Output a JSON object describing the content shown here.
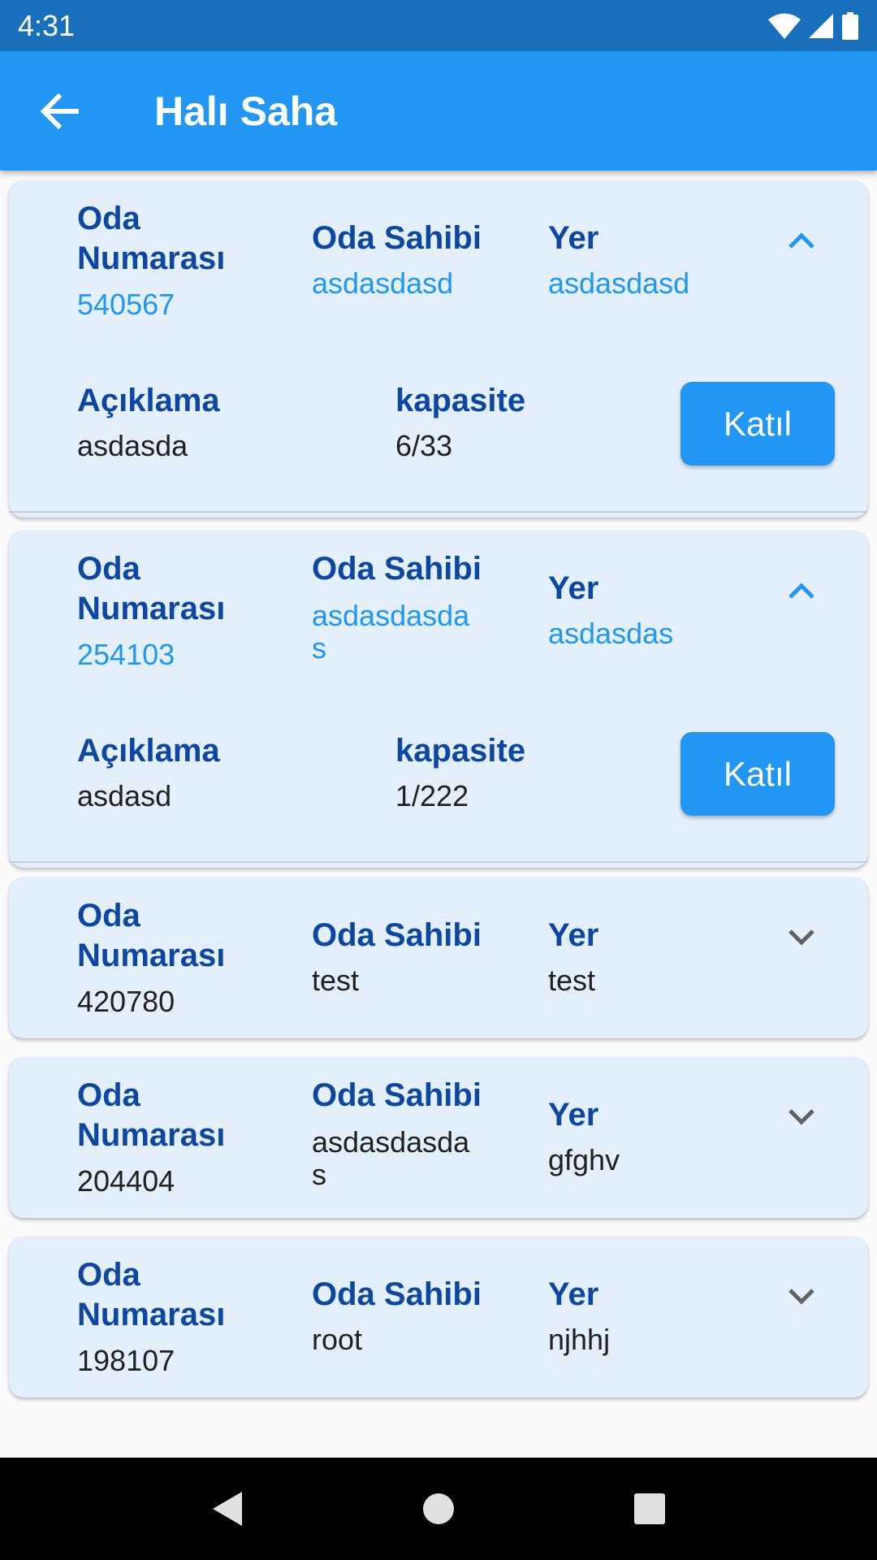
{
  "status_bar": {
    "time": "4:31"
  },
  "app_bar": {
    "title": "Halı Saha"
  },
  "labels": {
    "room_number": "Oda\nNumarası",
    "room_owner": "Oda Sahibi",
    "location": "Yer",
    "description": "Açıklama",
    "capacity": "kapasite",
    "join": "Katıl"
  },
  "rooms": [
    {
      "number": "540567",
      "owner": "asdasdasd",
      "location": "asdasdasd",
      "description": "asdasda",
      "capacity": "6/33",
      "expanded": true
    },
    {
      "number": "254103",
      "owner": "asdasdasdas",
      "location": "asdasdas",
      "description": "asdasd",
      "capacity": "1/222",
      "expanded": true
    },
    {
      "number": "420780",
      "owner": "test",
      "location": "test",
      "expanded": false
    },
    {
      "number": "204404",
      "owner": "asdasdasdas",
      "location": "gfghv",
      "expanded": false
    },
    {
      "number": "198107",
      "owner": "root",
      "location": "njhhj",
      "expanded": false
    }
  ],
  "colors": {
    "status_bar": "#1a6fba",
    "app_bar": "#2196f3",
    "card": "#e3f0fb",
    "label": "#0d47a1",
    "accent": "#2196f3"
  }
}
